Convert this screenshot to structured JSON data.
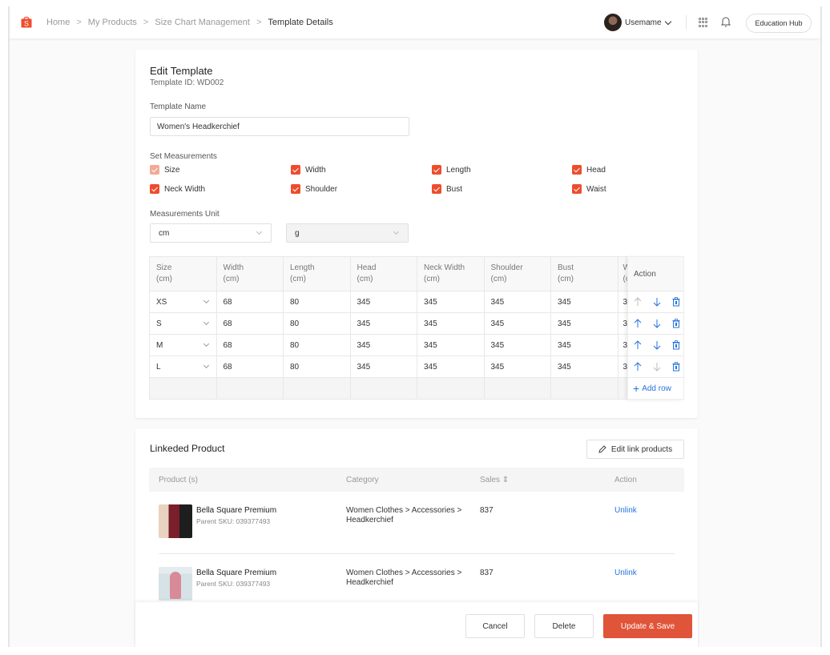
{
  "topbar": {
    "breadcrumb": [
      "Home",
      "My Products",
      "Size Chart Management",
      "Template Details"
    ],
    "username": "Usemame",
    "education_hub": "Education Hub",
    "brand_color": "#ee4d2d"
  },
  "edit": {
    "title": "Edit Template",
    "template_id": "Template ID: WD002",
    "name_label": "Template Name",
    "name_value": "Women's Headkerchief",
    "measurements_label": "Set Measurements",
    "measurements": [
      {
        "label": "Size",
        "checked": true,
        "disabled": true
      },
      {
        "label": "Width",
        "checked": true
      },
      {
        "label": "Length",
        "checked": true
      },
      {
        "label": "Head",
        "checked": true
      },
      {
        "label": "Neck Width",
        "checked": true
      },
      {
        "label": "Shoulder",
        "checked": true
      },
      {
        "label": "Bust",
        "checked": true
      },
      {
        "label": "Waist",
        "checked": true
      }
    ],
    "unit_label": "Measurements Unit",
    "unit_length": "cm",
    "unit_weight": "g"
  },
  "size_table": {
    "columns": [
      {
        "name": "Size",
        "unit": "(cm)"
      },
      {
        "name": "Width",
        "unit": "(cm)"
      },
      {
        "name": "Length",
        "unit": "(cm)"
      },
      {
        "name": "Head",
        "unit": "(cm)"
      },
      {
        "name": "Neck Width",
        "unit": "(cm)"
      },
      {
        "name": "Shoulder",
        "unit": "(cm)"
      },
      {
        "name": "Bust",
        "unit": "(cm)"
      },
      {
        "name": "W",
        "unit": "(c"
      }
    ],
    "action_label": "Action",
    "add_row_label": "Add row",
    "rows": [
      {
        "size": "XS",
        "values": [
          "68",
          "80",
          "345",
          "345",
          "345",
          "345",
          "3"
        ]
      },
      {
        "size": "S",
        "values": [
          "68",
          "80",
          "345",
          "345",
          "345",
          "345",
          "3"
        ]
      },
      {
        "size": "M",
        "values": [
          "68",
          "80",
          "345",
          "345",
          "345",
          "345",
          "3"
        ]
      },
      {
        "size": "L",
        "values": [
          "68",
          "80",
          "345",
          "345",
          "345",
          "345",
          "3"
        ]
      }
    ]
  },
  "linked": {
    "title": "Linkeded Product",
    "edit_button": "Edit link products",
    "columns": [
      "Product (s)",
      "Category",
      "Sales",
      "Action"
    ],
    "products": [
      {
        "name": "Bella Square Premium",
        "sku": "Parent SKU: 039377493",
        "category": "Women Clothes > Accessories > Headkerchief",
        "sales": "837",
        "action": "Unlink"
      },
      {
        "name": "Bella Square Premium",
        "sku": "Parent SKU: 039377493",
        "category": "Women Clothes > Accessories > Headkerchief",
        "sales": "837",
        "action": "Unlink"
      }
    ]
  },
  "footer": {
    "cancel": "Cancel",
    "delete": "Delete",
    "save": "Update & Save"
  }
}
